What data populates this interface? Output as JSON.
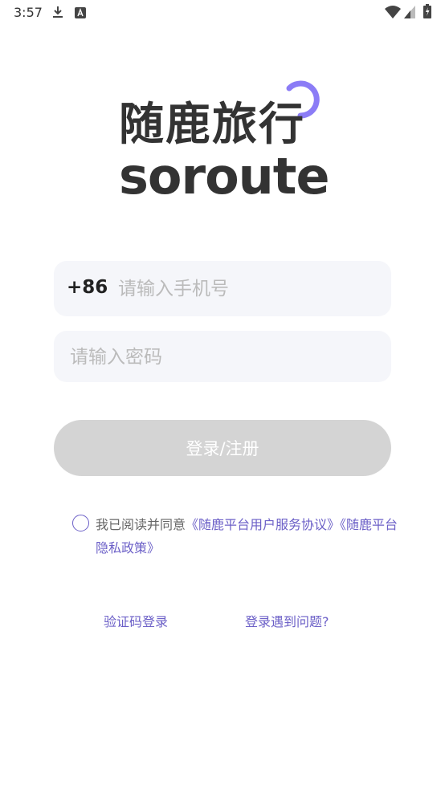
{
  "status_bar": {
    "time": "3:57",
    "icons": [
      "download-icon",
      "a-badge-icon",
      "wifi-icon",
      "signal-icon",
      "battery-icon"
    ]
  },
  "logo": {
    "chinese": "随鹿旅行",
    "english": "soroute",
    "accent_color": "#8b7cf6"
  },
  "phone": {
    "country_code": "+86",
    "placeholder": "请输入手机号"
  },
  "password": {
    "placeholder": "请输入密码"
  },
  "login_button": {
    "label": "登录/注册"
  },
  "agreement": {
    "prefix": "我已阅读并同意",
    "user_agreement": "《随鹿平台用户服务协议》",
    "privacy_policy": "《随鹿平台隐私政策》",
    "link_color": "#6b5fc7"
  },
  "links": {
    "sms_login": "验证码登录",
    "login_help": "登录遇到问题?"
  }
}
